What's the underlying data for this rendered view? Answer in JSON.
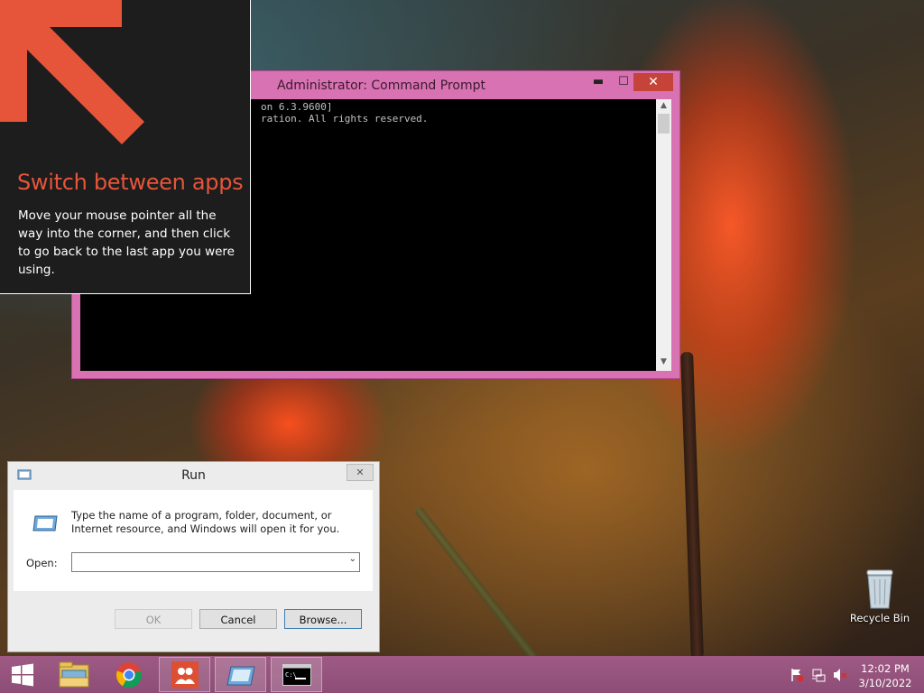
{
  "cmd": {
    "title": "Administrator: Command Prompt",
    "min_glyph": "▬",
    "max_glyph": "☐",
    "close_glyph": "✕",
    "line1": "on 6.3.9600]",
    "line2": "ration. All rights reserved.",
    "scroll_up": "▲",
    "scroll_down": "▼",
    "border_color": "#d872b2"
  },
  "tip": {
    "title": "Switch between apps",
    "body": "Move your mouse pointer all the way into the corner, and then click to go back to the last app you were using.",
    "accent": "#e6553a",
    "icon": "arrow-up-left-icon"
  },
  "run": {
    "title": "Run",
    "close_glyph": "✕",
    "description": "Type the name of a program, folder, document, or Internet resource, and Windows will open it for you.",
    "open_label": "Open:",
    "open_value": "",
    "ok_label": "OK",
    "cancel_label": "Cancel",
    "browse_label": "Browse...",
    "dropdown_glyph": "⌄"
  },
  "desktop": {
    "recycle_label": "Recycle Bin"
  },
  "taskbar": {
    "apps": [
      "start",
      "file-explorer",
      "chrome",
      "people",
      "run",
      "command-prompt"
    ],
    "time": "12:02 PM",
    "date": "3/10/2022",
    "color": "#9e5a84"
  }
}
